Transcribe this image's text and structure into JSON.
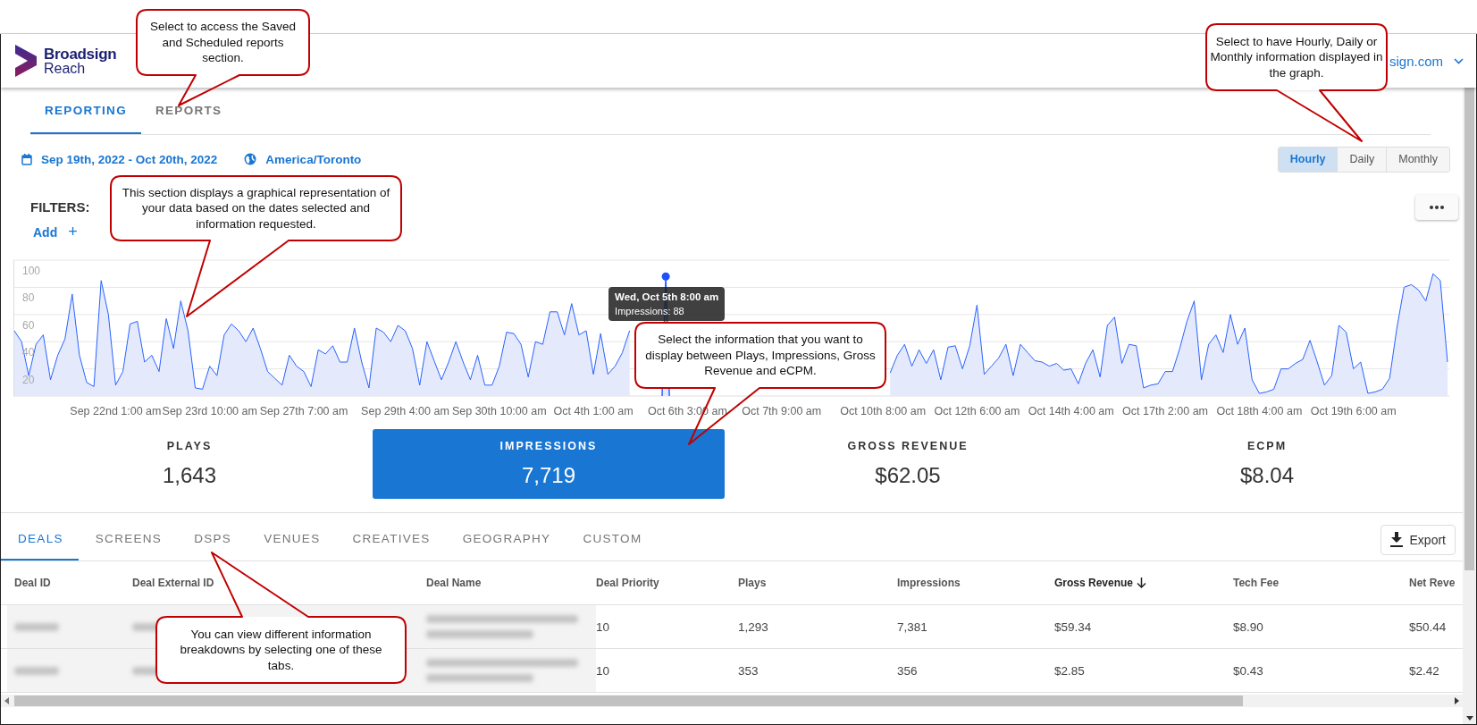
{
  "header": {
    "logo_name": "Broadsign",
    "logo_sub": "Reach",
    "user": "sign.com"
  },
  "tabs": [
    {
      "label": "REPORTING",
      "selected": true
    },
    {
      "label": "REPORTS",
      "selected": false
    }
  ],
  "date_range": "Sep 19th, 2022 - Oct 20th, 2022",
  "timezone": "America/Toronto",
  "granularity": [
    {
      "label": "Hourly",
      "selected": true
    },
    {
      "label": "Daily",
      "selected": false
    },
    {
      "label": "Monthly",
      "selected": false
    }
  ],
  "filters": {
    "label": "FILTERS:",
    "add": "Add",
    "add_symbol": "+"
  },
  "chart": {
    "tooltip_text": "Impressions: 88",
    "chart_data": {
      "type": "area",
      "grid": true,
      "ylim": [
        0,
        100
      ],
      "yticks": [
        20,
        40,
        60,
        80,
        100
      ],
      "categories": [
        null,
        null,
        null,
        null,
        null,
        null,
        null,
        null,
        null,
        null,
        null,
        null,
        null,
        null,
        "Sep 22nd 1:00 am",
        null,
        null,
        null,
        null,
        null,
        null,
        null,
        null,
        null,
        null,
        null,
        null,
        "Sep 23rd 10:00 am",
        null,
        null,
        null,
        null,
        null,
        null,
        null,
        null,
        null,
        null,
        null,
        null,
        "Sep 27th 7:00 am",
        null,
        null,
        null,
        null,
        null,
        null,
        null,
        null,
        null,
        null,
        null,
        null,
        null,
        "Sep 29th 4:00 am",
        null,
        null,
        null,
        null,
        null,
        null,
        null,
        null,
        null,
        null,
        null,
        null,
        "Sep 30th 10:00 am",
        null,
        null,
        null,
        null,
        null,
        null,
        null,
        null,
        null,
        null,
        null,
        null,
        "Oct 4th 1:00 am",
        null,
        null,
        null,
        null,
        null,
        null,
        null,
        null,
        null,
        null,
        null,
        null,
        "Oct 6th 3:00 am",
        null,
        null,
        null,
        null,
        null,
        null,
        null,
        null,
        null,
        null,
        null,
        null,
        "Oct 7th 9:00 am",
        null,
        null,
        null,
        null,
        null,
        null,
        null,
        null,
        null,
        null,
        null,
        null,
        null,
        "Oct 10th 8:00 am",
        null,
        null,
        null,
        null,
        null,
        null,
        null,
        null,
        null,
        null,
        null,
        null,
        "Oct 12th 6:00 am",
        null,
        null,
        null,
        null,
        null,
        null,
        null,
        null,
        null,
        null,
        null,
        null,
        "Oct 14th 4:00 am",
        null,
        null,
        null,
        null,
        null,
        null,
        null,
        null,
        null,
        null,
        null,
        null,
        "Oct 17th 2:00 am",
        null,
        null,
        null,
        null,
        null,
        null,
        null,
        null,
        null,
        null,
        null,
        null,
        "Oct 18th 4:00 am",
        null,
        null,
        null,
        null,
        null,
        null,
        null,
        null,
        null,
        null,
        null,
        null,
        "Oct 19th 6:00 am",
        null,
        null,
        null,
        null,
        null,
        null,
        null,
        null,
        null,
        null,
        null,
        null,
        null
      ],
      "series": [
        {
          "color": "#2962ff",
          "values": [
            48,
            40,
            15,
            38,
            45,
            12,
            30,
            42,
            75,
            30,
            10,
            7,
            85,
            60,
            8,
            18,
            53,
            55,
            25,
            30,
            18,
            57,
            35,
            70,
            48,
            6,
            5,
            22,
            15,
            45,
            53,
            48,
            40,
            50,
            35,
            18,
            13,
            8,
            30,
            22,
            18,
            7,
            34,
            31,
            37,
            25,
            25,
            50,
            25,
            6,
            50,
            47,
            40,
            52,
            48,
            35,
            8,
            40,
            26,
            12,
            25,
            40,
            25,
            12,
            30,
            8,
            8,
            22,
            47,
            46,
            38,
            14,
            40,
            38,
            62,
            62,
            45,
            68,
            45,
            48,
            16,
            46,
            16,
            22,
            32,
            48,
            null,
            null,
            null,
            null,
            88,
            null,
            null,
            null,
            null,
            null,
            null,
            null,
            null,
            null,
            null,
            null,
            null,
            null,
            null,
            null,
            null,
            null,
            null,
            null,
            null,
            null,
            null,
            null,
            null,
            null,
            null,
            null,
            null,
            null,
            null,
            17,
            30,
            38,
            22,
            34,
            24,
            34,
            12,
            36,
            37,
            20,
            37,
            67,
            16,
            22,
            28,
            38,
            15,
            38,
            32,
            26,
            25,
            22,
            24,
            19,
            20,
            9,
            24,
            34,
            14,
            52,
            58,
            24,
            38,
            37,
            6,
            8,
            9,
            18,
            18,
            35,
            55,
            70,
            12,
            38,
            45,
            32,
            60,
            38,
            50,
            12,
            2,
            3,
            5,
            20,
            20,
            24,
            27,
            41,
            25,
            8,
            15,
            52,
            47,
            20,
            25,
            2,
            3,
            5,
            13,
            50,
            80,
            82,
            78,
            70,
            90,
            85,
            25
          ]
        }
      ],
      "annotations": [
        {
          "y": 88,
          "text": "Wed, Oct 5th 8:00 am"
        }
      ]
    }
  },
  "metrics": [
    {
      "label": "PLAYS",
      "value": "1,643",
      "selected": false
    },
    {
      "label": "IMPRESSIONS",
      "value": "7,719",
      "selected": true
    },
    {
      "label": "GROSS REVENUE",
      "value": "$62.05",
      "selected": false
    },
    {
      "label": "ECPM",
      "value": "$8.04",
      "selected": false
    }
  ],
  "table_tabs": [
    {
      "label": "DEALS",
      "selected": true
    },
    {
      "label": "SCREENS",
      "selected": false
    },
    {
      "label": "DSPS",
      "selected": false
    },
    {
      "label": "VENUES",
      "selected": false
    },
    {
      "label": "CREATIVES",
      "selected": false
    },
    {
      "label": "GEOGRAPHY",
      "selected": false
    },
    {
      "label": "CUSTOM",
      "selected": false
    }
  ],
  "export": "Export",
  "table": {
    "columns": [
      {
        "label": "Deal ID",
        "kind": "blurred",
        "sorted": false
      },
      {
        "label": "Deal External ID",
        "kind": "blurred",
        "sorted": false
      },
      {
        "label": "Deal Name",
        "kind": "blurred",
        "sorted": false
      },
      {
        "label": "Deal Priority",
        "kind": "text",
        "sorted": false
      },
      {
        "label": "Plays",
        "kind": "text",
        "sorted": false
      },
      {
        "label": "Impressions",
        "kind": "text",
        "sorted": false
      },
      {
        "label": "Gross Revenue",
        "kind": "text",
        "sorted": true
      },
      {
        "label": "Tech Fee",
        "kind": "text",
        "sorted": false
      },
      {
        "label": "Net Reve",
        "kind": "text",
        "sorted": false
      }
    ],
    "rows": [
      {
        "cells": [
          "",
          "",
          "",
          "10",
          "1,293",
          "7,381",
          "$59.34",
          "$8.90",
          "$50.44"
        ]
      },
      {
        "cells": [
          "",
          "",
          "",
          "10",
          "353",
          "356",
          "$2.85",
          "$0.43",
          "$2.42"
        ]
      }
    ]
  },
  "callouts": [
    {
      "text": "Select to access the Saved and Scheduled reports section."
    },
    {
      "text": "Select to have Hourly, Daily or Monthly information displayed in the graph."
    },
    {
      "text": "This section displays a graphical representation of your data based on the dates selected and information requested."
    },
    {
      "text": "Select the information that you want to display between Plays, Impressions, Gross Revenue and eCPM."
    },
    {
      "text": "You can view different information breakdowns by selecting one of these tabs."
    }
  ]
}
